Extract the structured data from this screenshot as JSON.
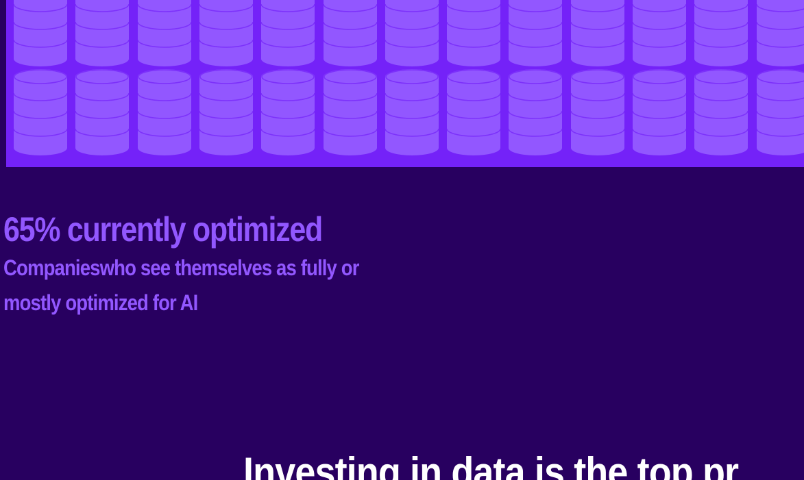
{
  "illustration": {
    "icon": "database-icon",
    "rows": 2,
    "columns": 13,
    "background_color": "#7422F8",
    "icon_color": "#9257FF"
  },
  "stat": {
    "headline": "65% currently optimized",
    "caption": "Companieswho see themselves as fully or mostly optimized for AI"
  },
  "section": {
    "heading": "Investing in data is the top pr"
  },
  "colors": {
    "page_background": "#280060",
    "accent": "#9257FF",
    "heading": "#FFFFFF"
  }
}
